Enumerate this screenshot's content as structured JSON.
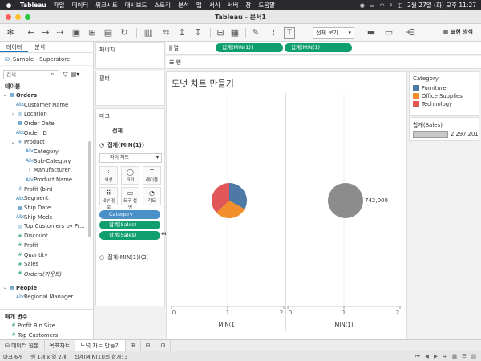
{
  "menubar": {
    "app": "Tableau",
    "items": [
      "파일",
      "데이터",
      "워크시트",
      "대시보드",
      "스토리",
      "분석",
      "맵",
      "서식",
      "서버",
      "창",
      "도움말"
    ],
    "datetime": "2월 27일 (화) 오후 11:27"
  },
  "window": {
    "title": "Tableau - 문서1"
  },
  "toolbar": {
    "view_select": "전체 보기",
    "present_label": "표현 방식"
  },
  "left_panel": {
    "tabs": [
      "데이터",
      "분석"
    ],
    "datasource": "Sample - Superstore",
    "search_placeholder": "검색",
    "tables_label": "테이블",
    "orders_label": "Orders",
    "fields": [
      {
        "label": "Customer Name",
        "icon": "Abc",
        "indent": 1
      },
      {
        "label": "Location",
        "icon": "geo",
        "indent": 1,
        "caret": "›"
      },
      {
        "label": "Order Date",
        "icon": "date",
        "indent": 1
      },
      {
        "label": "Order ID",
        "icon": "Abc",
        "indent": 1
      },
      {
        "label": "Product",
        "icon": "hier",
        "indent": 1,
        "caret": "⌄"
      },
      {
        "label": "Category",
        "icon": "Abc",
        "indent": 2
      },
      {
        "label": "Sub-Category",
        "icon": "Abc",
        "indent": 2
      },
      {
        "label": "Manufacturer",
        "icon": "clip",
        "indent": 2
      },
      {
        "label": "Product Name",
        "icon": "Abc",
        "indent": 2
      },
      {
        "label": "Profit (bin)",
        "icon": "bin",
        "indent": 1
      },
      {
        "label": "Segment",
        "icon": "Abc",
        "indent": 1
      },
      {
        "label": "Ship Date",
        "icon": "date",
        "indent": 1
      },
      {
        "label": "Ship Mode",
        "icon": "Abc",
        "indent": 1
      },
      {
        "label": "Top Customers by Pr...",
        "icon": "set",
        "indent": 1
      },
      {
        "label": "Discount",
        "icon": "#",
        "indent": 1,
        "measure": true
      },
      {
        "label": "Profit",
        "icon": "#",
        "indent": 1,
        "measure": true
      },
      {
        "label": "Quantity",
        "icon": "#",
        "indent": 1,
        "measure": true
      },
      {
        "label": "Sales",
        "icon": "#",
        "indent": 1,
        "measure": true
      },
      {
        "label": "Orders(카운트)",
        "icon": "#",
        "indent": 1,
        "measure": true,
        "italic": true
      }
    ],
    "people_label": "People",
    "people_fields": [
      {
        "label": "Regional Manager",
        "icon": "Abc"
      }
    ],
    "params_label": "매개 변수",
    "params": [
      {
        "label": "Profit Bin Size"
      },
      {
        "label": "Top Customers"
      }
    ]
  },
  "shelves": {
    "pages": "페이지",
    "filters": "필터",
    "marks": "마크",
    "all": "전체",
    "marks1": "집계(MIN(1))",
    "mark_type": "파이 차트",
    "buttons": [
      {
        "label": "색상",
        "icon": "⁘"
      },
      {
        "label": "크기",
        "icon": "◯"
      },
      {
        "label": "레이블",
        "icon": "T"
      },
      {
        "label": "세부 정보",
        "icon": "⠿"
      },
      {
        "label": "도구 설명",
        "icon": "▭"
      },
      {
        "label": "각도",
        "icon": "◔"
      }
    ],
    "pill_category": "Category",
    "pill_sales1": "합계(Sales)",
    "pill_sales2": "합계(Sales)",
    "marks2": "집계(MIN(1))(2)",
    "columns_label": "열",
    "rows_label": "행",
    "col_pill1": "집계(MIN(1))",
    "col_pill2": "집계(MIN(1))"
  },
  "viz": {
    "title": "도넛 차트 만들기",
    "axis_label": "MIN(1)",
    "ticks": [
      "0",
      "1",
      "2"
    ],
    "pie_label": "742,000"
  },
  "chart_data": {
    "type": "pie",
    "categories": [
      "Furniture",
      "Office Supplies",
      "Technology"
    ],
    "values": [
      33,
      30,
      37
    ],
    "colors": [
      "#4e79a7",
      "#f28e2b",
      "#e15759"
    ],
    "second_pie_color": "#8c8c8c",
    "second_pie_label": "742,000",
    "xlabel": "MIN(1)",
    "xlim": [
      0,
      2
    ]
  },
  "legend": {
    "title": "Category",
    "items": [
      {
        "label": "Furniture",
        "color": "#4e79a7"
      },
      {
        "label": "Office Supplies",
        "color": "#f28e2b"
      },
      {
        "label": "Technology",
        "color": "#e15759"
      }
    ],
    "size_title": "합계(Sales)",
    "size_value": "2,297,201"
  },
  "sheet_tabs": {
    "source": "데이터 원본",
    "tab1": "목표차트",
    "tab2": "도넛 차트 만들기"
  },
  "status": {
    "marks": "마크 6개",
    "rows": "행 1개 x 열 2개",
    "sum": "집계(MIN(1))의 합계: 3"
  }
}
